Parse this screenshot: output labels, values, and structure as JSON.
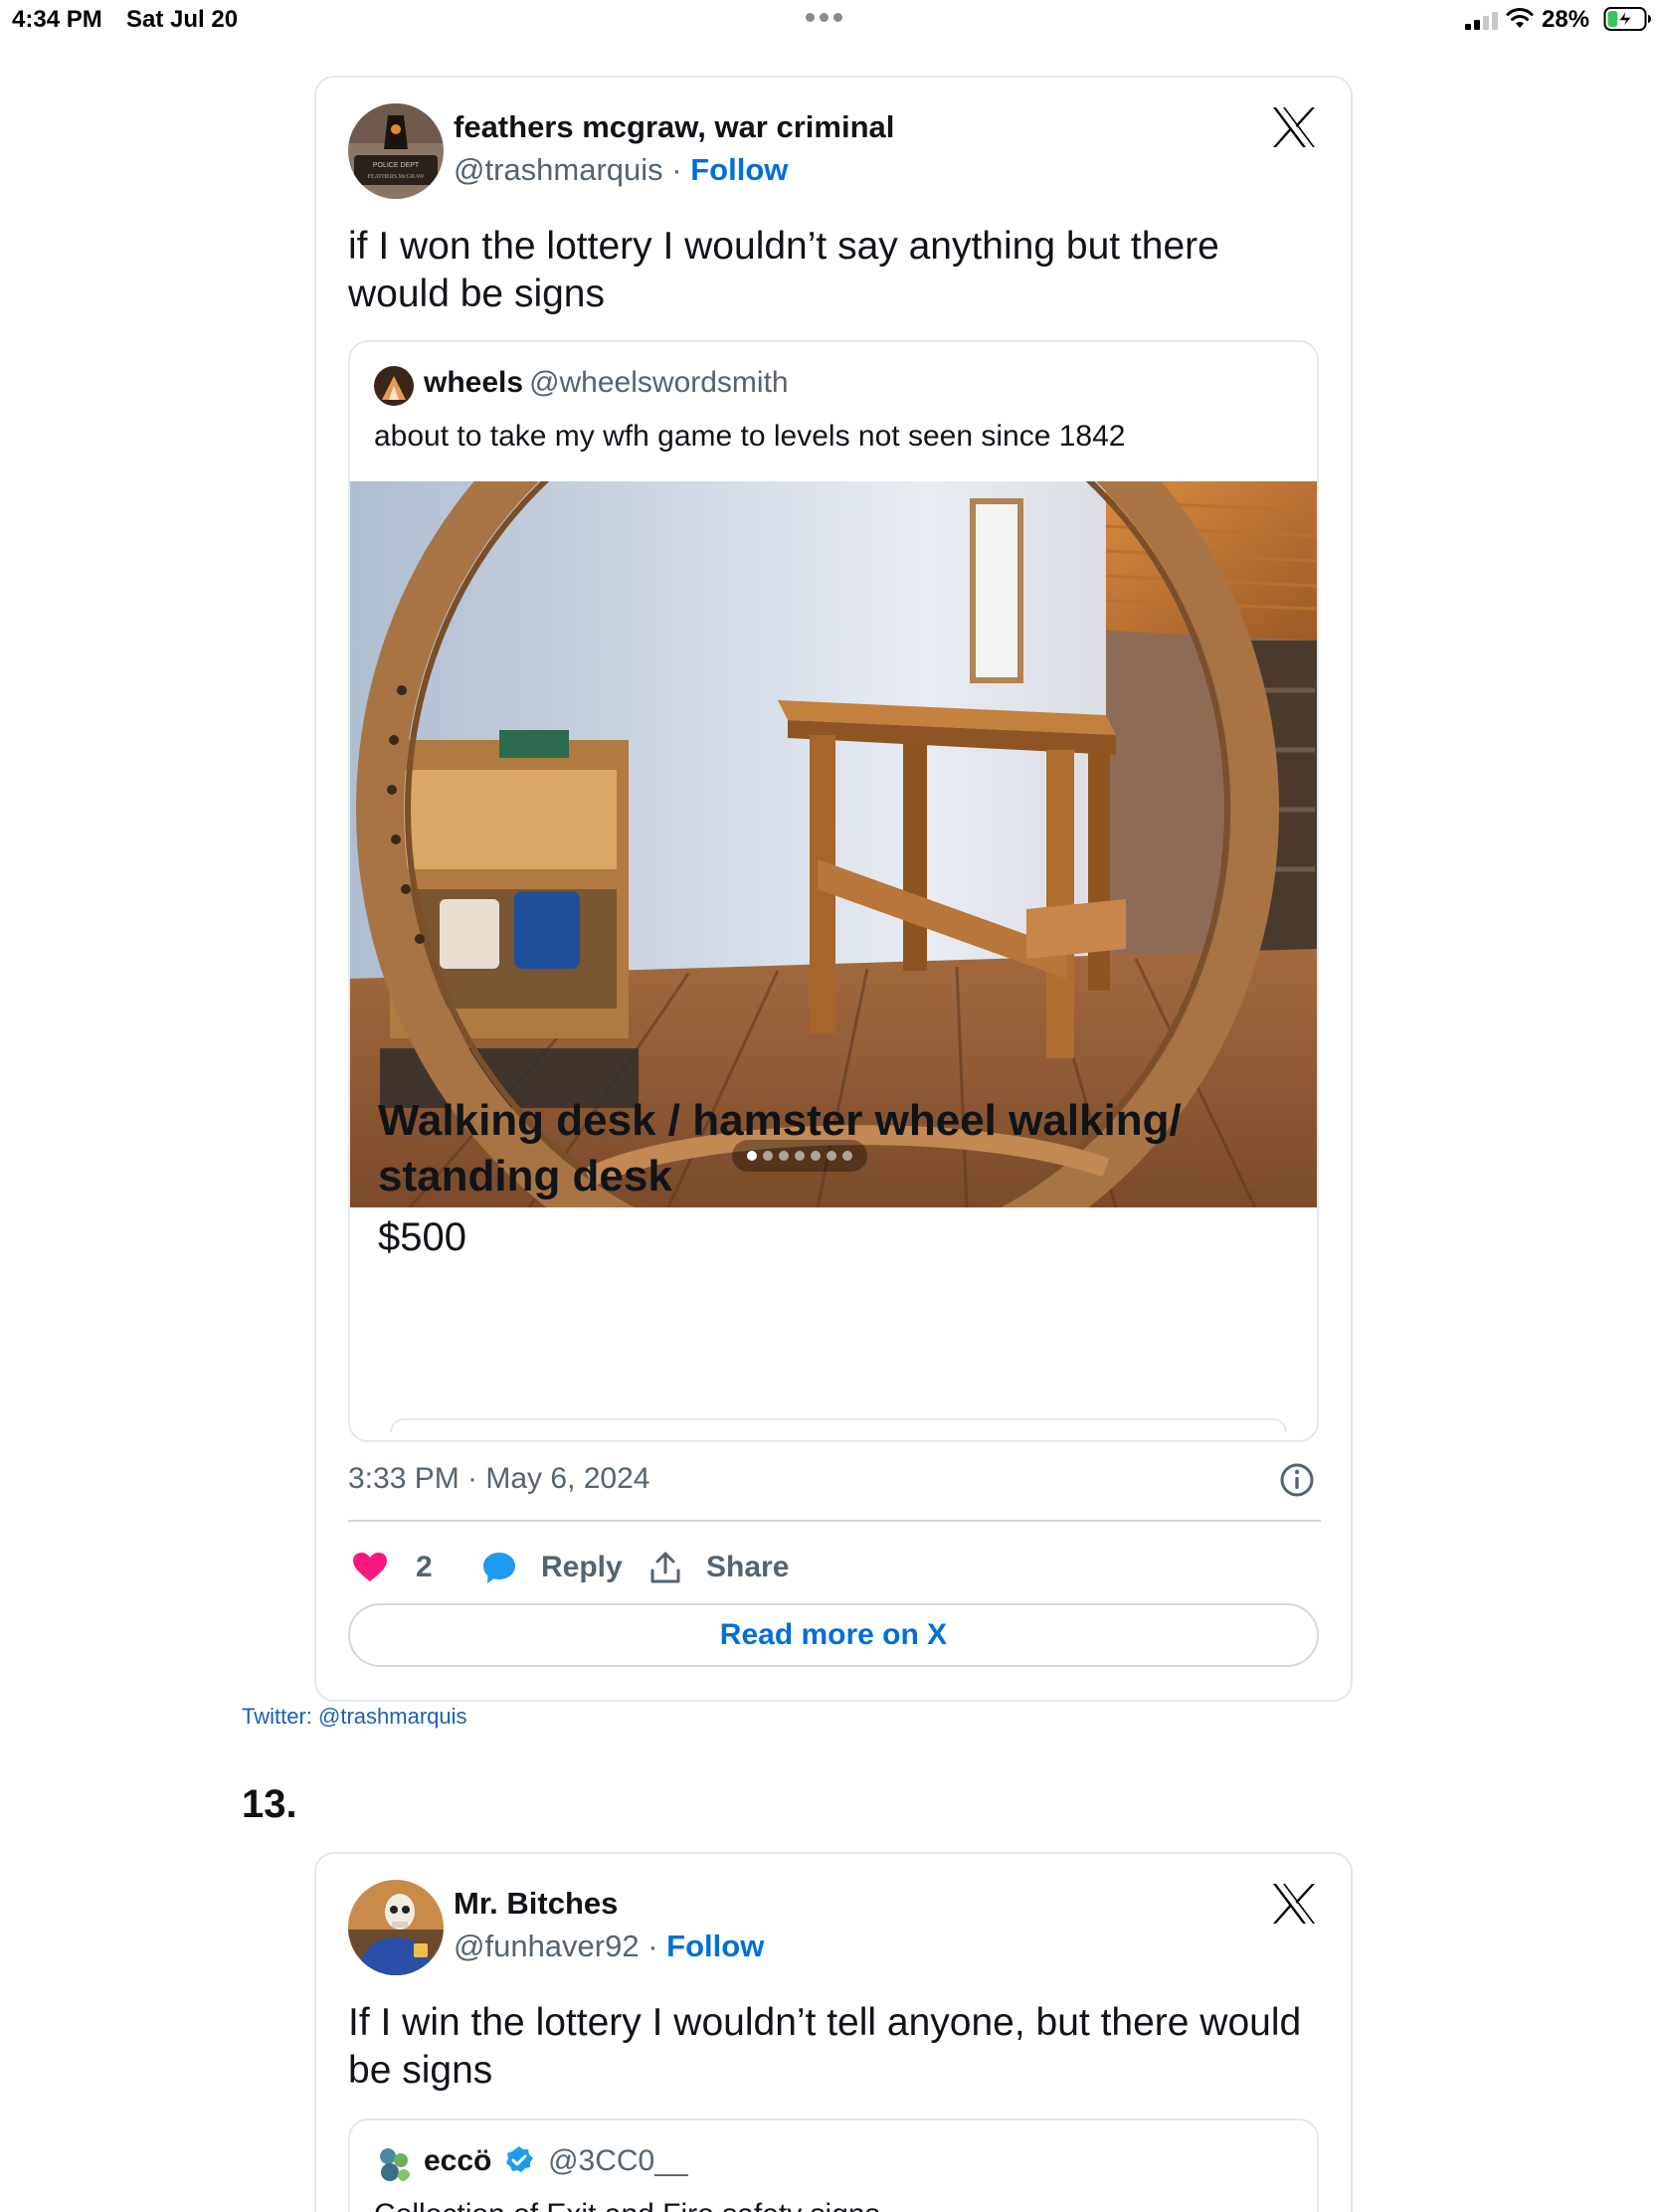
{
  "status_bar": {
    "time": "4:34 PM",
    "date": "Sat Jul 20",
    "battery_percent": "28%",
    "battery_level": 0.28,
    "icons": [
      "cellular-signal-icon",
      "wifi-icon",
      "battery-charging-icon"
    ]
  },
  "tweet1": {
    "author_name": "feathers mcgraw, war criminal",
    "handle": "@trashmarquis",
    "separator": " · ",
    "follow_label": "Follow",
    "avatar_badge_line1": "POLICE DEPT",
    "avatar_badge_line2": "FEATHERS McGRAW",
    "text": "if I won the lottery I wouldn’t say anything but there would be signs",
    "quote": {
      "author_name": "wheels",
      "handle": "@wheelswordsmith",
      "text": "about to take my wfh game to levels not seen since 1842",
      "listing_title": "Walking desk / hamster wheel walking/ standing desk",
      "listing_price": "$500",
      "carousel_dots": 7,
      "carousel_active_index": 0
    },
    "timestamp": "3:33 PM · May 6, 2024",
    "like_count": "2",
    "reply_label": "Reply",
    "share_label": "Share",
    "read_more_label": "Read more on X"
  },
  "credit": "Twitter: @trashmarquis",
  "item_number": "13.",
  "tweet2": {
    "author_name": "Mr. Bitches",
    "handle": "@funhaver92",
    "separator": " · ",
    "follow_label": "Follow",
    "text": "If I win the lottery I wouldn’t tell anyone, but there would be signs",
    "quote": {
      "author_name": "eccö",
      "handle": "@3CC0__",
      "text": "Collection of Exit and Fire safety signs",
      "verified": true
    }
  },
  "colors": {
    "link_blue": "#006fd6",
    "like_pink": "#f91880",
    "reply_blue": "#1d9bf0",
    "verified_blue": "#1d9bf0",
    "muted_text": "#536471",
    "border": "#e1e8ed"
  }
}
